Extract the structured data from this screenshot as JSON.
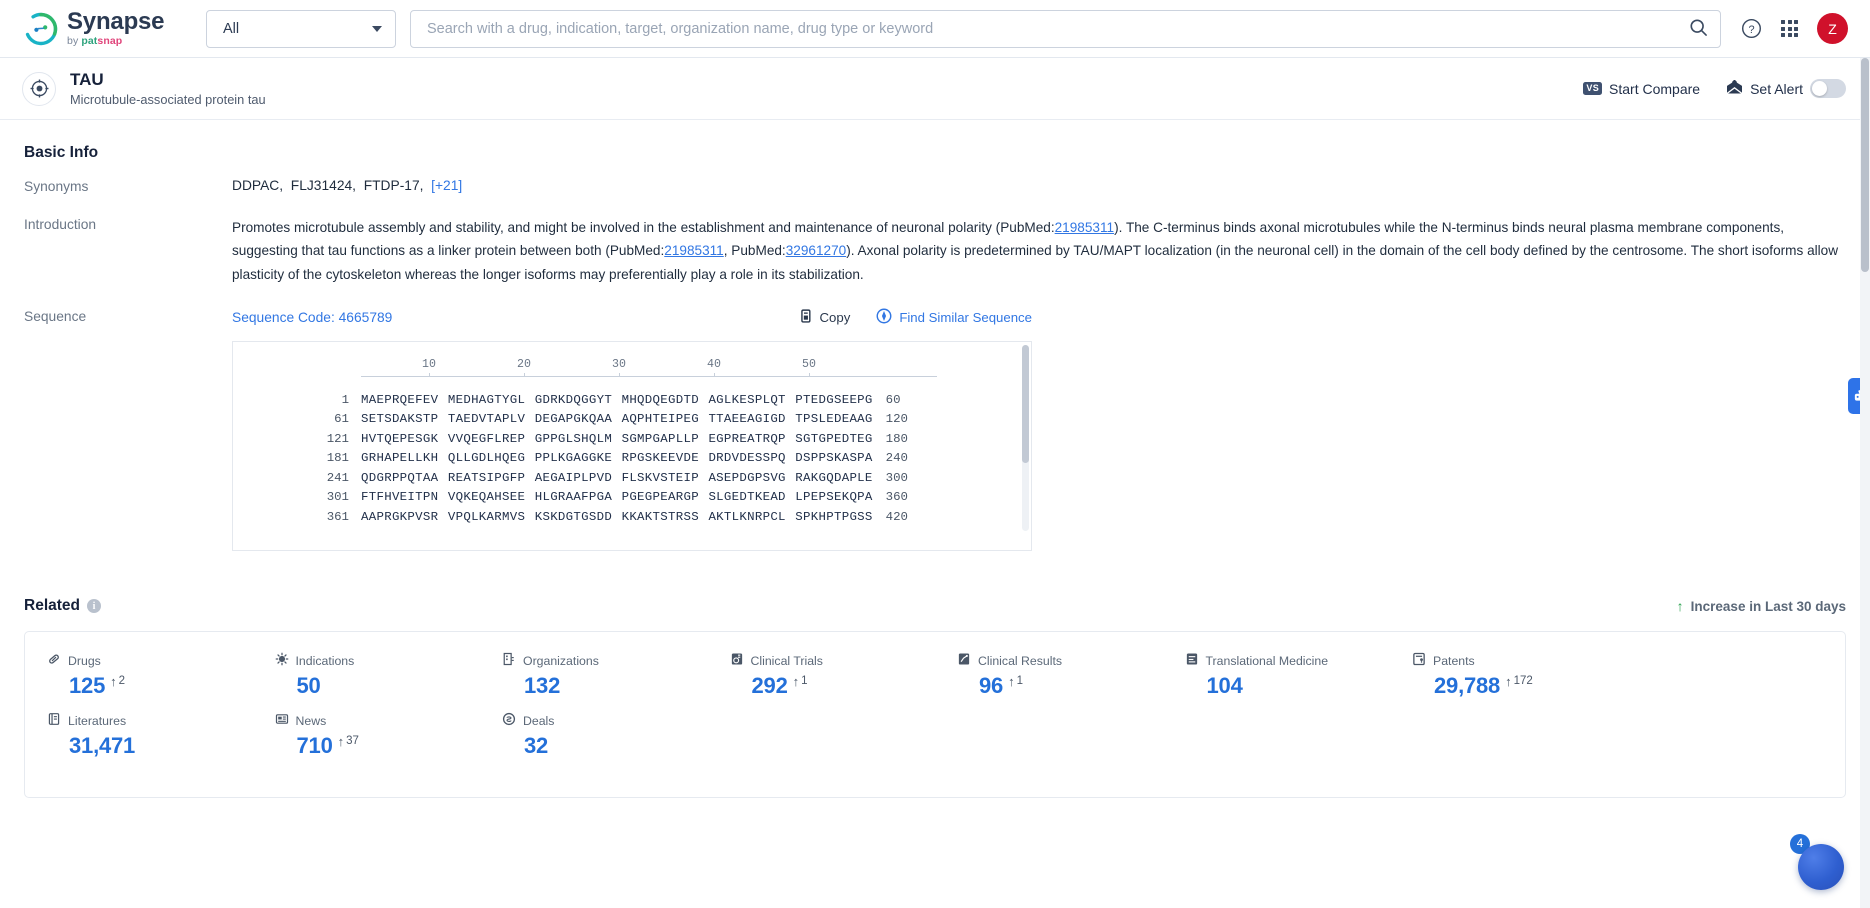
{
  "header": {
    "brand_name": "Synapse",
    "brand_by": "by",
    "brand_pat": "pat",
    "brand_snap": "snap",
    "scope_value": "All",
    "search_placeholder": "Search with a drug, indication, target, organization name, drug type or keyword",
    "search_value": "",
    "help_icon": "question-circle-icon",
    "apps_icon": "app-grid-icon",
    "avatar_initial": "Z"
  },
  "entity": {
    "icon": "target-icon",
    "name": "TAU",
    "description": "Microtubule-associated protein tau",
    "compare_label": "Start Compare",
    "compare_badge": "VS",
    "alert_label": "Set Alert",
    "alert_enabled": false
  },
  "basic_info": {
    "section_title": "Basic Info",
    "synonyms_label": "Synonyms",
    "synonyms": [
      "DDPAC",
      "FLJ31424",
      "FTDP-17"
    ],
    "synonyms_more": "[+21]",
    "introduction_label": "Introduction",
    "introduction": {
      "p1": "Promotes microtubule assembly and stability, and might be involved in the establishment and maintenance of neuronal polarity (PubMed:",
      "ref1": "21985311",
      "p2": "). The C-terminus binds axonal microtubules while the N-terminus binds neural plasma membrane components, suggesting that tau functions as a linker protein between both (PubMed:",
      "ref2": "21985311",
      "p3": ", PubMed:",
      "ref3": "32961270",
      "p4": "). Axonal polarity is predetermined by TAU/MAPT localization (in the neuronal cell) in the domain of the cell body defined by the centrosome. The short isoforms allow plasticity of the cytoskeleton whereas the longer isoforms may preferentially play a role in its stabilization."
    }
  },
  "sequence": {
    "label": "Sequence",
    "code_label": "Sequence Code: 4665789",
    "copy_label": "Copy",
    "copy_icon": "copy-icon",
    "find_similar_label": "Find Similar Sequence",
    "find_similar_icon": "compass-icon",
    "ruler_ticks": [
      10,
      20,
      30,
      40,
      50
    ],
    "rows": [
      {
        "start": "1",
        "chunks": [
          "MAEPRQEFEV",
          "MEDHAGTYGL",
          "GDRKDQGGYT",
          "MHQDQEGDTD",
          "AGLKESPLQT",
          "PTEDGSEEPG"
        ],
        "end": "60"
      },
      {
        "start": "61",
        "chunks": [
          "SETSDAKSTP",
          "TAEDVTAPLV",
          "DEGAPGKQAA",
          "AQPHTEIPEG",
          "TTAEEAGIGD",
          "TPSLEDEAAG"
        ],
        "end": "120"
      },
      {
        "start": "121",
        "chunks": [
          "HVTQEPESGK",
          "VVQEGFLREP",
          "GPPGLSHQLM",
          "SGMPGAPLLP",
          "EGPREATRQP",
          "SGTGPEDTEG"
        ],
        "end": "180"
      },
      {
        "start": "181",
        "chunks": [
          "GRHAPELLKH",
          "QLLGDLHQEG",
          "PPLKGAGGKE",
          "RPGSKEEVDE",
          "DRDVDESSPQ",
          "DSPPSKASPA"
        ],
        "end": "240"
      },
      {
        "start": "241",
        "chunks": [
          "QDGRPPQTAA",
          "REATSIPGFP",
          "AEGAIPLPVD",
          "FLSKVSTEIP",
          "ASEPDGPSVG",
          "RAKGQDAPLE"
        ],
        "end": "300"
      },
      {
        "start": "301",
        "chunks": [
          "FTFHVEITPN",
          "VQKEQAHSEE",
          "HLGRAAFPGA",
          "PGEGPEARGP",
          "SLGEDTKEAD",
          "LPEPSEKQPA"
        ],
        "end": "360"
      },
      {
        "start": "361",
        "chunks": [
          "AAPRGKPVSR",
          "VPQLKARMVS",
          "KSKDGTGSDD",
          "KKAKTSTRSS",
          "AKTLKNRPCL",
          "SPKHPTPGSS"
        ],
        "end": "420"
      }
    ]
  },
  "related": {
    "section_title": "Related",
    "info_glyph": "i",
    "legend_label": "Increase in Last 30 days",
    "legend_arrow": "↑",
    "stats": [
      {
        "icon": "capsule-icon",
        "label": "Drugs",
        "value": "125",
        "delta": "2"
      },
      {
        "icon": "virus-icon",
        "label": "Indications",
        "value": "50",
        "delta": ""
      },
      {
        "icon": "building-icon",
        "label": "Organizations",
        "value": "132",
        "delta": ""
      },
      {
        "icon": "trial-flask-icon",
        "label": "Clinical Trials",
        "value": "292",
        "delta": "1"
      },
      {
        "icon": "results-icon",
        "label": "Clinical Results",
        "value": "96",
        "delta": "1"
      },
      {
        "icon": "translate-icon",
        "label": "Translational Medicine",
        "value": "104",
        "delta": ""
      },
      {
        "icon": "patent-icon",
        "label": "Patents",
        "value": "29,788",
        "delta": "172"
      },
      {
        "icon": "book-icon",
        "label": "Literatures",
        "value": "31,471",
        "delta": ""
      },
      {
        "icon": "news-icon",
        "label": "News",
        "value": "710",
        "delta": "37"
      },
      {
        "icon": "deal-icon",
        "label": "Deals",
        "value": "32",
        "delta": ""
      }
    ]
  },
  "widgets": {
    "rail_icon": "robot-assistant-icon",
    "chat_badge": "4",
    "chat_icon": "chat-bubble-icon"
  },
  "colors": {
    "accent_blue": "#2470d9",
    "link_blue": "#3277e3",
    "increase_green": "#2aa14f",
    "avatar_red": "#d0112b",
    "text_dark": "#16213a"
  }
}
